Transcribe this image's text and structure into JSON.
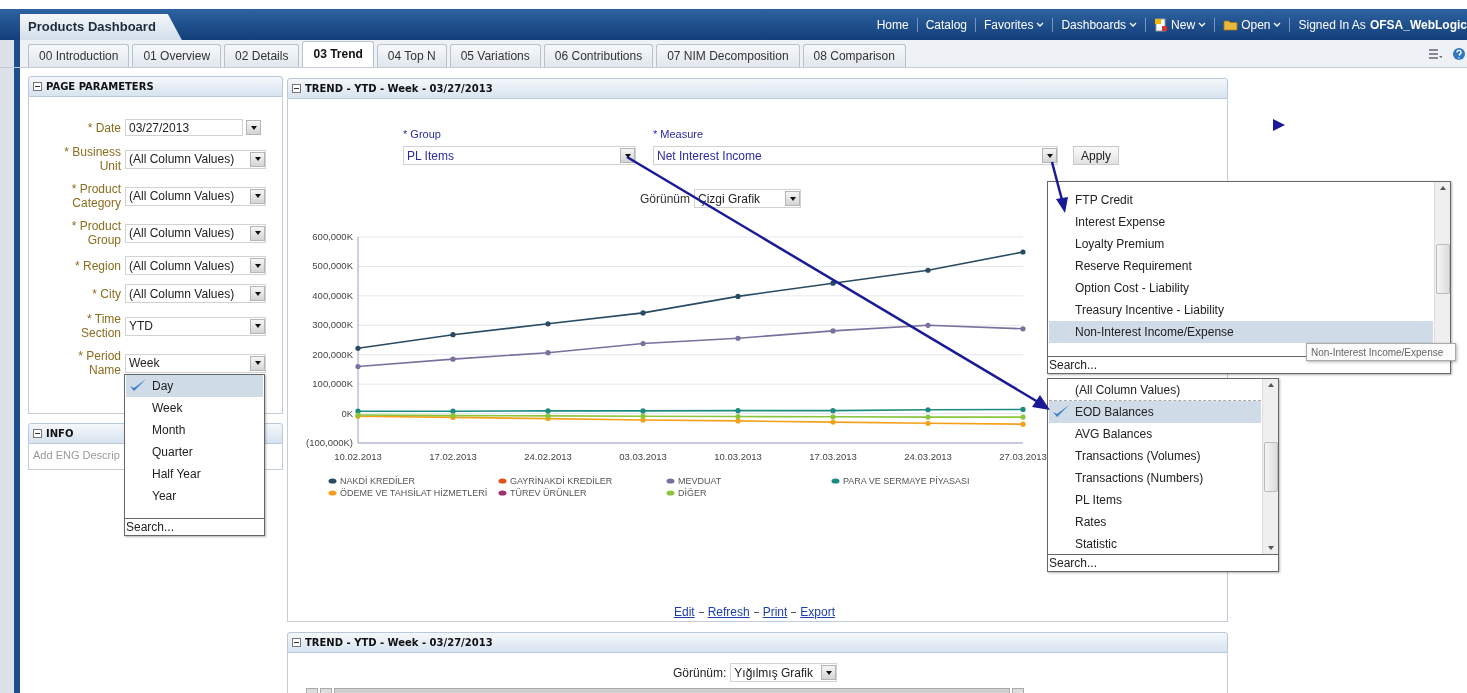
{
  "header": {
    "title": "Products Dashboard",
    "nav": [
      {
        "kind": "link",
        "label": "Home"
      },
      {
        "kind": "link",
        "label": "Catalog"
      },
      {
        "kind": "menu",
        "label": "Favorites"
      },
      {
        "kind": "menu",
        "label": "Dashboards"
      },
      {
        "kind": "new-menu",
        "label": "New"
      },
      {
        "kind": "open-menu",
        "label": "Open"
      }
    ],
    "signed_in_label": "Signed In As",
    "user": "OFSA_WebLogic"
  },
  "tabs": [
    {
      "label": "00 Introduction",
      "selected": false
    },
    {
      "label": "01 Overview",
      "selected": false
    },
    {
      "label": "02 Details",
      "selected": false
    },
    {
      "label": "03 Trend",
      "selected": true
    },
    {
      "label": "04 Top N",
      "selected": false
    },
    {
      "label": "05 Variations",
      "selected": false
    },
    {
      "label": "06 Contributions",
      "selected": false
    },
    {
      "label": "07 NIM Decomposition",
      "selected": false
    },
    {
      "label": "08 Comparison",
      "selected": false
    }
  ],
  "page_parameters": {
    "title": "PAGE PARAMETERS",
    "fields": [
      {
        "kind": "date",
        "label": "* Date",
        "value": "03/27/2013"
      },
      {
        "kind": "select",
        "label": "* Business Unit",
        "value": "(All Column Values)"
      },
      {
        "kind": "select",
        "label": "* Product Category",
        "value": "(All Column Values)"
      },
      {
        "kind": "select",
        "label": "* Product Group",
        "value": "(All Column Values)"
      },
      {
        "kind": "select",
        "label": "* Region",
        "value": "(All Column Values)"
      },
      {
        "kind": "select",
        "label": "* City",
        "value": "(All Column Values)"
      },
      {
        "kind": "select",
        "label": "* Time Section",
        "value": "YTD"
      },
      {
        "kind": "select",
        "label": "* Period Name",
        "value": "Week"
      }
    ],
    "period_dropdown": {
      "options": [
        {
          "label": "Day",
          "selected": true
        },
        {
          "label": "Week",
          "selected": false
        },
        {
          "label": "Month",
          "selected": false
        },
        {
          "label": "Quarter",
          "selected": false
        },
        {
          "label": "Half Year",
          "selected": false
        },
        {
          "label": "Year",
          "selected": false
        }
      ],
      "search_placeholder": "Search..."
    }
  },
  "info": {
    "title": "INFO",
    "text": "Add ENG Descrip"
  },
  "trend": {
    "title": "TREND - YTD - Week - 03/27/2013",
    "group": {
      "label": "* Group",
      "value": "PL Items"
    },
    "measure": {
      "label": "* Measure",
      "value": "Net Interest Income"
    },
    "apply": "Apply",
    "view": {
      "label": "Görünüm",
      "value": "Çizgi Grafik"
    },
    "chart_data": {
      "type": "line",
      "categories": [
        "10.02.2013",
        "17.02.2013",
        "24.02.2013",
        "03.03.2013",
        "10.03.2013",
        "17.03.2013",
        "24.03.2013",
        "27.03.2013"
      ],
      "ylim": [
        -100000,
        600000
      ],
      "yticks": [
        {
          "value": -100000,
          "label": "(100,000K)"
        },
        {
          "value": 0,
          "label": "0K"
        },
        {
          "value": 100000,
          "label": "100,000K"
        },
        {
          "value": 200000,
          "label": "200,000K"
        },
        {
          "value": 300000,
          "label": "300,000K"
        },
        {
          "value": 400000,
          "label": "400,000K"
        },
        {
          "value": 500000,
          "label": "500,000K"
        },
        {
          "value": 600000,
          "label": "600,000K"
        }
      ],
      "series": [
        {
          "name": "NAKDİ KREDİLER",
          "color": "#284b63",
          "values": [
            222000,
            268000,
            305000,
            342000,
            398000,
            443000,
            487000,
            549000
          ]
        },
        {
          "name": "GAYRİNAKDİ KREDİLER",
          "color": "#e0501a",
          "values": [
            null,
            null,
            null,
            null,
            null,
            null,
            null,
            null
          ]
        },
        {
          "name": "MEVDUAT",
          "color": "#7b6f9e",
          "values": [
            160000,
            185000,
            207000,
            238000,
            256000,
            281000,
            300000,
            288000
          ]
        },
        {
          "name": "PARA VE SERMAYE PİYASASI",
          "color": "#1b8a80",
          "values": [
            8000,
            8000,
            9000,
            9000,
            10000,
            10000,
            13000,
            14000
          ]
        },
        {
          "name": "ÖDEME VE TAHSİLAT HİZMETLERİ",
          "color": "#f5a01a",
          "values": [
            -9000,
            -13000,
            -17000,
            -22000,
            -25000,
            -29000,
            -33000,
            -36000
          ]
        },
        {
          "name": "TÜREV ÜRÜNLER",
          "color": "#a0306e",
          "values": [
            null,
            null,
            null,
            null,
            null,
            null,
            null,
            null
          ]
        },
        {
          "name": "DİĞER",
          "color": "#8cc43c",
          "values": [
            -5000,
            -7000,
            -8000,
            -9000,
            -10000,
            -11000,
            -12000,
            -12000
          ]
        }
      ],
      "grid": true
    },
    "links": [
      "Edit",
      "Refresh",
      "Print",
      "Export"
    ],
    "measure_dropdown": {
      "options": [
        {
          "label": "FTP Credit",
          "hovered": false
        },
        {
          "label": "Interest Expense",
          "hovered": false
        },
        {
          "label": "Loyalty Premium",
          "hovered": false
        },
        {
          "label": "Reserve Requirement",
          "hovered": false
        },
        {
          "label": "Option Cost - Liability",
          "hovered": false
        },
        {
          "label": "Treasury Incentive - Liability",
          "hovered": false
        },
        {
          "label": "Non-Interest Income/Expense",
          "hovered": true
        }
      ],
      "search_placeholder": "Search...",
      "tooltip": "Non-Interest Income/Expense"
    },
    "group_dropdown": {
      "options": [
        {
          "label": "(All Column Values)",
          "selected": false
        },
        {
          "label": "EOD Balances",
          "selected": true
        },
        {
          "label": "AVG Balances",
          "selected": false
        },
        {
          "label": "Transactions (Volumes)",
          "selected": false
        },
        {
          "label": "Transactions (Numbers)",
          "selected": false
        },
        {
          "label": "PL Items",
          "selected": false
        },
        {
          "label": "Rates",
          "selected": false
        },
        {
          "label": "Statistic",
          "selected": false
        }
      ],
      "search_placeholder": "Search..."
    }
  },
  "trend_2": {
    "title": "TREND - YTD - Week - 03/27/2013",
    "view": {
      "label": "Görünüm:",
      "value": "Yığılmış Grafik"
    }
  }
}
